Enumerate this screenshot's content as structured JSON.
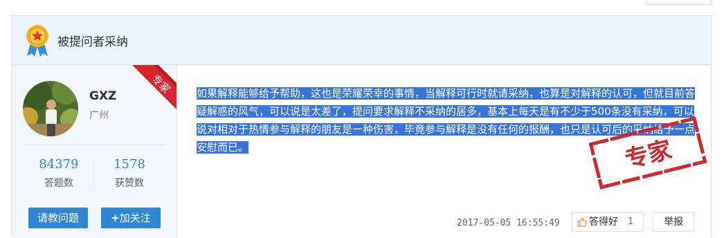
{
  "panel": {
    "title": "被提问者采纳"
  },
  "user": {
    "name": "GXZ",
    "location": "广州",
    "badge": "专家",
    "stats": [
      {
        "value": "84379",
        "label": "答题数"
      },
      {
        "value": "1578",
        "label": "获赞数"
      }
    ],
    "ask_button": "请教问题",
    "follow_button": "加关注",
    "follow_icon": "+"
  },
  "answer": {
    "text": "如果解释能够给予帮助，这也是荣耀荣幸的事情，当解释可行时就请采纳，也算是对解释的认可，但就目前答疑解惑的风气，可以说是太差了，提问要求解释不采纳的居多，基本上每天是有不少于500条没有采纳，可以说对相对于热情参与解释的朋友是一种伤害，毕竟参与解释是没有任何的报酬，也只是认可后的采纳给予一点安慰而已。",
    "stamp": "专家",
    "timestamp": "2017-05-05 16:55:49",
    "like_label": "答得好",
    "like_count": "1",
    "report_label": "举报"
  },
  "colors": {
    "accent_blue": "#2f86d4",
    "stat_blue": "#3a84c5",
    "selection": "#3875d7",
    "ribbon_red": "#d9252b",
    "stamp_red": "#cc2a2f"
  },
  "icons": {
    "medal": "medal-icon",
    "thumb": "thumb-up-icon"
  }
}
